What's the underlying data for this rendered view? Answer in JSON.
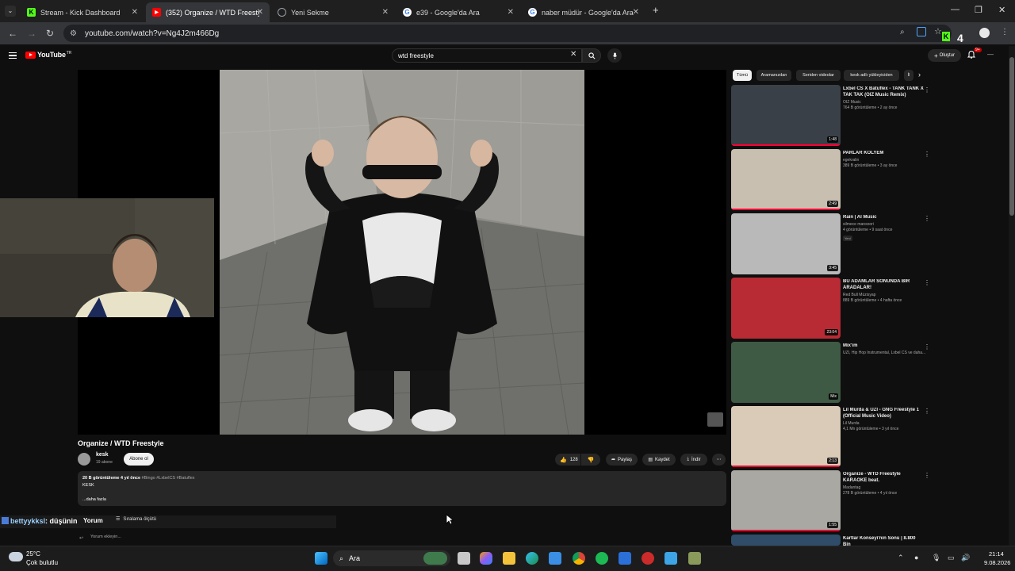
{
  "browser": {
    "tabs": [
      {
        "title": "Stream - Kick Dashboard",
        "active": false,
        "color": "#53fc18"
      },
      {
        "title": "(352) Organize / WTD Freestyle",
        "active": true,
        "color": "#ff0000"
      },
      {
        "title": "Yeni Sekme",
        "active": false,
        "color": "#9aa0a6"
      },
      {
        "title": "e39 - Google'da Ara",
        "active": false,
        "color": "#4285f4"
      },
      {
        "title": "naber müdür - Google'da Ara",
        "active": false,
        "color": "#4285f4"
      }
    ],
    "new_tab_label": "+",
    "url": "youtube.com/watch?v=Ng4J2m466Dg",
    "extension_badge": "4"
  },
  "youtube": {
    "logo_text": "YouTube",
    "logo_country": "TR",
    "search_query": "wtd freestyle",
    "create_label": "Oluştur",
    "notif_count": "9+"
  },
  "video": {
    "title": "Organize / WTD Freestyle",
    "channel": "kesk",
    "subs": "19 abone",
    "subscribe_label": "Abone ol",
    "likes": "128",
    "share_label": "Paylaş",
    "save_label": "Kaydet",
    "download_label": "İndir",
    "desc_meta": "20 B görüntüleme  4 yıl önce",
    "desc_tags": "#Bingo #LxbelCS #Batuflex",
    "desc_body": "KESK",
    "desc_more": "...daha fazla",
    "comments_label": "Yorum",
    "sort_label": "Sıralama ölçütü",
    "comment_placeholder": "Yorum ekleyin..."
  },
  "chat": {
    "user": "bettyykksl",
    "message": ": düşünin"
  },
  "sidebar": {
    "chips": [
      "Tümü",
      "Aramanızdan",
      "Seriden videolar",
      "kesk adlı yükleyiciden",
      "İl"
    ],
    "items": [
      {
        "title": "Lxbel CS X Batuflex - TANK TANK X TAK TAK (OIZ Music Remix)",
        "channel": "OIZ Music",
        "meta": "764 B görüntüleme • 2 ay önce",
        "duration": "1:48",
        "progress": 1.0,
        "thumb": "#3a4048"
      },
      {
        "title": "PARLAR KOLYEM",
        "channel": "egekralin",
        "meta": "389 B görüntüleme • 3 ay önce",
        "duration": "2:49",
        "progress": 1.0,
        "thumb": "#c9bfb0"
      },
      {
        "title": "Rain | AI Music",
        "channel": "silmece mansoori",
        "meta": "4 görüntüleme • 9 saat önce",
        "duration": "3:45",
        "progress": 0.0,
        "thumb": "#b8b9b8",
        "badge": "Yeni"
      },
      {
        "title": "BU ADAMLAR SONUNDA BİR ARADALAR!",
        "channel": "Red Bull Müzisyap",
        "meta": "889 B görüntüleme • 4 hafta önce",
        "duration": "23:04",
        "progress": 0.0,
        "thumb": "#b82a34"
      },
      {
        "title": "Mix'im",
        "channel": "UZI, Hip Hop Instrumental, Lxbel CS ve daha...",
        "meta": "",
        "duration": "Mix",
        "progress": 0.0,
        "thumb": "#3f5a44"
      },
      {
        "title": "Lil Murda & UZI - GNG Freestyle 1 (Official Music Video)",
        "channel": "Lil Murda",
        "meta": "4,1 Mn görüntüleme • 3 yıl önce",
        "duration": "2:13",
        "progress": 1.0,
        "thumb": "#d9cbb7"
      },
      {
        "title": "Organize - WTD Freestyle KARAOKE beat.",
        "channel": "Madantag",
        "meta": "278 B görüntüleme • 4 yıl önce",
        "duration": "1:55",
        "progress": 1.0,
        "thumb": "#a9a8a3"
      },
      {
        "title": "Kartlar Konseyi'nin Sonu | 8.800 Bin",
        "channel": "",
        "meta": "",
        "duration": "",
        "progress": 0.0,
        "thumb": "#2f4c68"
      }
    ]
  },
  "taskbar": {
    "temp": "25°C",
    "weather": "Çok bulutlu",
    "search_label": "Ara",
    "time": "21:14",
    "date": "9.08.2026"
  },
  "colors": {
    "bg": "#0f0f0f",
    "accent_red": "#ff0000",
    "progress_red": "#ff0033",
    "kick_green": "#53fc18"
  }
}
